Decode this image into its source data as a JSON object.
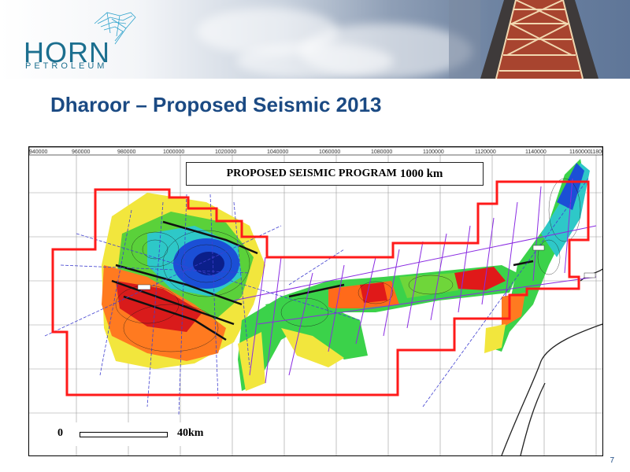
{
  "company": {
    "name": "HORN",
    "sub_name": "PETROLEUM",
    "brand_color": "#1c6f8f"
  },
  "slide": {
    "title": "Dharoor – Proposed Seismic 2013",
    "page_number": "7",
    "title_color": "#1b4a83"
  },
  "map": {
    "program_label": "PROPOSED SEISMIC PROGRAM",
    "program_length": "1000 km",
    "grid_labels_x": [
      "940000",
      "960000",
      "980000",
      "1000000",
      "1020000",
      "1040000",
      "1060000",
      "1080000",
      "1100000",
      "1120000",
      "1140000",
      "1160000",
      "11800"
    ],
    "scale_start": "0",
    "scale_end": "40km",
    "block_outline_color": "#ff1a1a",
    "proposed_line_color": "#8a2be2",
    "existing_line_color": "#4040d0"
  }
}
